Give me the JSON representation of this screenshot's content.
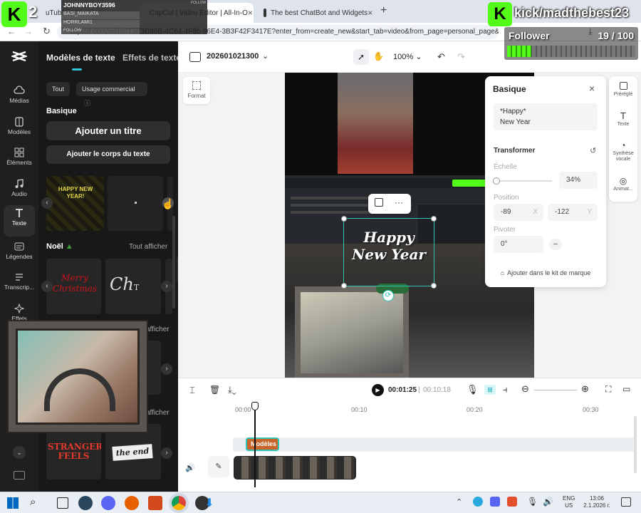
{
  "browser": {
    "tabs": [
      {
        "label": "uTube"
      },
      {
        "label": "CapCut | Video Editor | All-In-O"
      },
      {
        "label": "The best ChatBot and Widgets"
      }
    ],
    "url": "capcut.com/editor/13E3D86B-4C64-4F8b-96E4-3B3F42F3417E?enter_from=create_new&start_tab=video&from_page=personal_page&__a"
  },
  "stream_overlay": {
    "k2_label": "2",
    "chat_user": "JOHNNYBOY3596",
    "chat_follow": "FOLLOW",
    "chat_lines": [
      "BASI_MAIKATA",
      "HORRLAMI1",
      "FOLLOW"
    ],
    "channel": "kick/madthebest23",
    "follower_label": "Follower",
    "follower_count": "19 / 100"
  },
  "left_rail": {
    "items": [
      {
        "icon": "cloud-icon",
        "label": "Médias"
      },
      {
        "icon": "template-icon",
        "label": "Modèles"
      },
      {
        "icon": "elements-icon",
        "label": "Éléments"
      },
      {
        "icon": "music-icon",
        "label": "Audio"
      },
      {
        "icon": "text-icon",
        "label": "Texte"
      },
      {
        "icon": "captions-icon",
        "label": "Légendes"
      },
      {
        "icon": "transcript-icon",
        "label": "Transcrip..."
      },
      {
        "icon": "effects-icon",
        "label": "Effets"
      }
    ]
  },
  "text_panel": {
    "tab_active": "Modèles de texte",
    "tab_other": "Effets de texte",
    "filter_all": "Tout",
    "filter_commercial": "Usage commercial",
    "section_basic": "Basique",
    "add_title": "Ajouter un titre",
    "add_body": "Ajouter le corps du texte",
    "section_noel": "Noël",
    "see_all": "Tout afficher",
    "see_all_2": "afficher",
    "see_all_3": "afficher",
    "thumb_happy": "HAPPY NEW YEAR!",
    "thumb_merry": "Merry Christmas",
    "thumb_d": "d]",
    "thumb_stranger": "STRANGER FEELS",
    "thumb_end": "the end"
  },
  "toolbar": {
    "project_name": "202601021300",
    "zoom": "100%",
    "format_label": "Format"
  },
  "canvas": {
    "text_preview": [
      "Happy",
      "New Year"
    ]
  },
  "properties": {
    "title": "Basique",
    "text_value": [
      "*Happy*",
      "New Year"
    ],
    "section_transform": "Transformer",
    "scale_label": "Échelle",
    "scale_value": "34%",
    "scale_fraction": 0.34,
    "position_label": "Position",
    "pos_x": "-89",
    "pos_x_axis": "X",
    "pos_y": "-122",
    "pos_y_axis": "Y",
    "rotate_label": "Pivoter",
    "rotate_value": "0°",
    "brand_kit": "Ajouter dans le kit de marque"
  },
  "side_tabs": [
    {
      "icon": "preset-icon",
      "label": "Préréglé"
    },
    {
      "icon": "text-icon",
      "label": "Texte"
    },
    {
      "icon": "voice-icon",
      "label": "Synthèse vocale"
    },
    {
      "icon": "animation-icon",
      "label": "Animat..."
    }
  ],
  "timeline": {
    "current_time": "00:01:25",
    "total_time": "00:10:18",
    "ruler": [
      "00:00",
      "00:10",
      "00:20",
      "00:30"
    ],
    "text_clip": "Modèles"
  },
  "taskbar": {
    "lang": "ENG",
    "region": "US",
    "time": "13:06",
    "date": "2.1.2026 г."
  },
  "colors": {
    "kick_green": "#53fc18",
    "selection_cyan": "#2ec4b6",
    "accent_blue": "#00c1cd"
  }
}
